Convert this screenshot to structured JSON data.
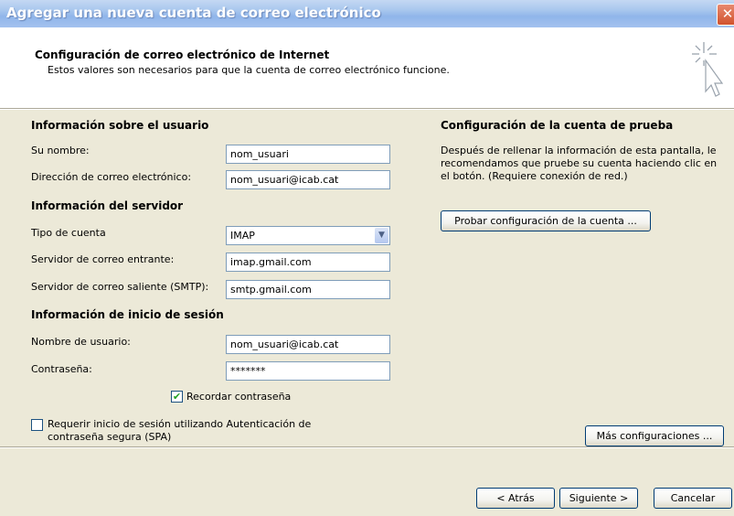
{
  "window": {
    "title": "Agregar una nueva cuenta de correo electrónico",
    "close_label": "✕"
  },
  "header": {
    "title": "Configuración de correo electrónico de Internet",
    "subtitle": "Estos valores son necesarios para que la cuenta de correo electrónico funcione."
  },
  "user_info": {
    "section_title": "Información sobre el usuario",
    "name_label": "Su nombre:",
    "name_value": "nom_usuari",
    "email_label": "Dirección de correo electrónico:",
    "email_value": "nom_usuari@icab.cat"
  },
  "server_info": {
    "section_title": "Información del servidor",
    "account_type_label": "Tipo de cuenta",
    "account_type_value": "IMAP",
    "incoming_label": "Servidor de correo entrante:",
    "incoming_value": "imap.gmail.com",
    "outgoing_label": "Servidor de correo saliente (SMTP):",
    "outgoing_value": "smtp.gmail.com"
  },
  "login_info": {
    "section_title": "Información de inicio de sesión",
    "username_label": "Nombre de usuario:",
    "username_value": "nom_usuari@icab.cat",
    "password_label": "Contraseña:",
    "password_value": "*******",
    "remember_label": "Recordar contraseña",
    "remember_checked": true,
    "spa_label_line1": "Requerir inicio de sesión utilizando Autenticación de",
    "spa_label_line2": "contraseña segura (SPA)",
    "spa_checked": false
  },
  "test_settings": {
    "section_title": "Configuración de la cuenta de prueba",
    "description_line1": "Después de rellenar la información de esta pantalla, le",
    "description_line2": "recomendamos que pruebe su cuenta haciendo clic en",
    "description_line3": "el botón. (Requiere conexión de red.)",
    "test_button_label": "Probar configuración de la cuenta ...",
    "more_settings_label": "Más configuraciones ..."
  },
  "footer": {
    "back_label": "< Atrás",
    "next_label": "Siguiente >",
    "cancel_label": "Cancelar"
  },
  "icons": {
    "wizard": "sparkle-cursor-icon",
    "dropdown": "chevron-down-icon",
    "check": "check-icon"
  },
  "colors": {
    "title_bar": "#a3c1ef",
    "dialog_background": "#ece9d8",
    "header_background": "#ffffff",
    "close_button": "#d1532d"
  }
}
